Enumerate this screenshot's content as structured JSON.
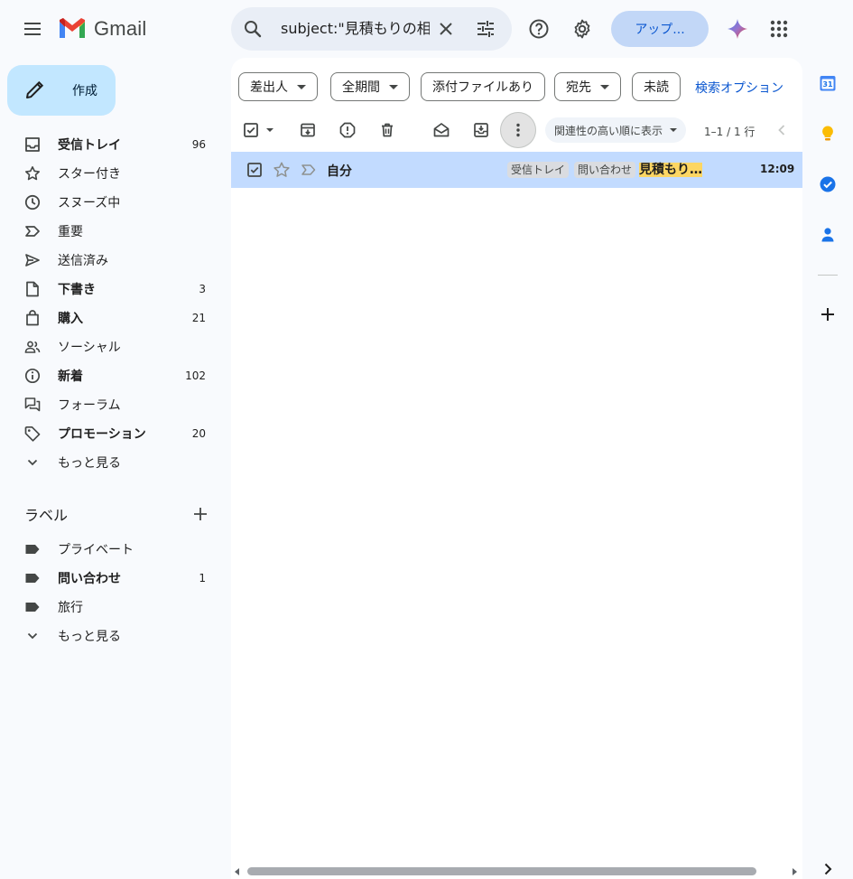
{
  "app": {
    "name": "Gmail"
  },
  "search": {
    "query": "subject:\"見積もりの相"
  },
  "header": {
    "upgrade_label": "アップ..."
  },
  "compose": {
    "label": "作成"
  },
  "nav": {
    "items": [
      {
        "label": "受信トレイ",
        "count": "96"
      },
      {
        "label": "スター付き",
        "count": ""
      },
      {
        "label": "スヌーズ中",
        "count": ""
      },
      {
        "label": "重要",
        "count": ""
      },
      {
        "label": "送信済み",
        "count": ""
      },
      {
        "label": "下書き",
        "count": "3"
      },
      {
        "label": "購入",
        "count": "21"
      },
      {
        "label": "ソーシャル",
        "count": ""
      },
      {
        "label": "新着",
        "count": "102"
      },
      {
        "label": "フォーラム",
        "count": ""
      },
      {
        "label": "プロモーション",
        "count": "20"
      },
      {
        "label": "もっと見る",
        "count": ""
      }
    ]
  },
  "labels": {
    "title": "ラベル",
    "items": [
      {
        "label": "プライベート",
        "count": ""
      },
      {
        "label": "問い合わせ",
        "count": "1"
      },
      {
        "label": "旅行",
        "count": ""
      },
      {
        "label": "もっと見る",
        "count": ""
      }
    ]
  },
  "filters": {
    "from": "差出人",
    "date": "全期間",
    "has_attachment": "添付ファイルあり",
    "to": "宛先",
    "unread": "未読",
    "advanced": "検索オプション"
  },
  "toolbar": {
    "sort_label": "関連性の高い順に表示",
    "pager": "1–1 / 1 行"
  },
  "messages": [
    {
      "sender": "自分",
      "tags": [
        "受信トレイ",
        "問い合わせ"
      ],
      "subject": "見積もり...",
      "time": "12:09",
      "selected": true
    }
  ],
  "colors": {
    "accent": "#0b57d0",
    "compose_bg": "#c2e7ff",
    "selected_row": "#c2dbff",
    "highlight": "#fdd663"
  }
}
